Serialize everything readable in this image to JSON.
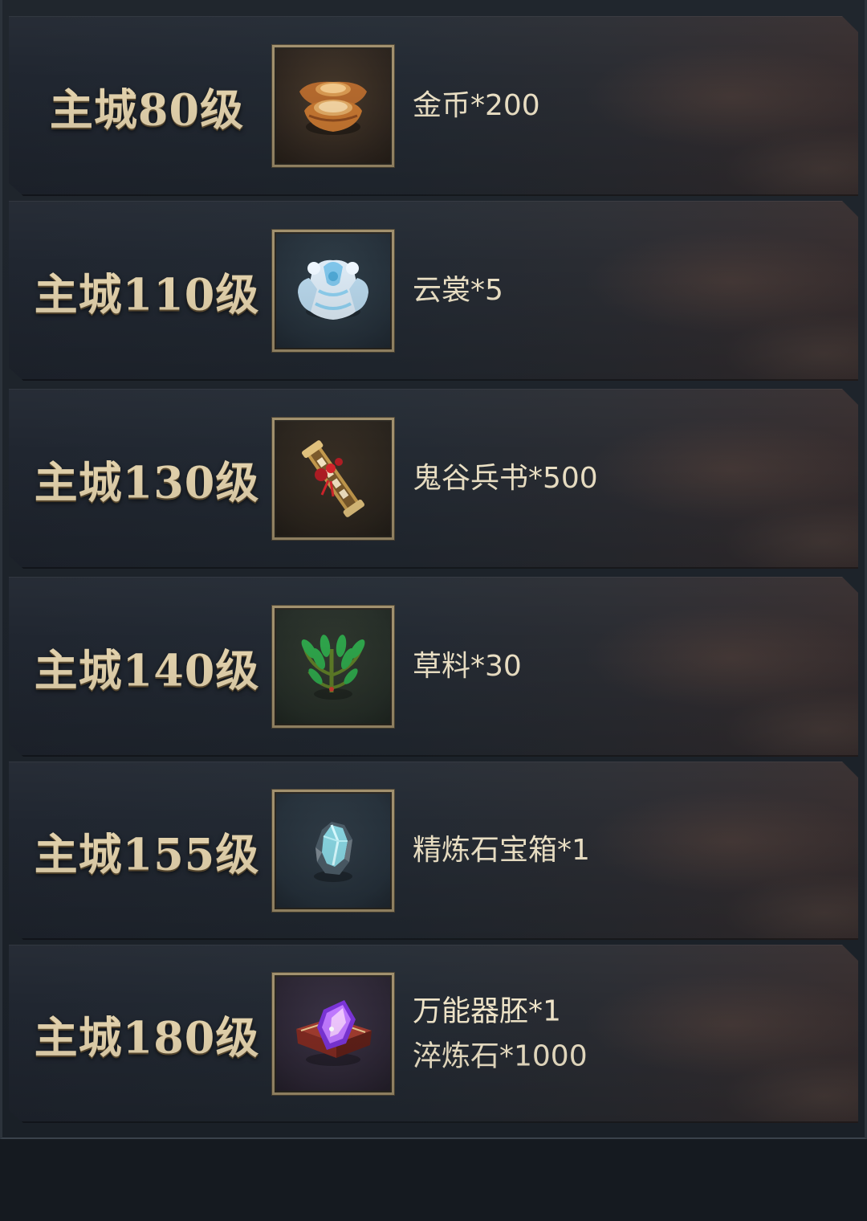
{
  "rows": [
    {
      "level": "主城80级",
      "icon": "gold-ingots",
      "rewards": [
        "金币*200"
      ]
    },
    {
      "level": "主城110级",
      "icon": "cloud-armor",
      "rewards": [
        "云裳*5"
      ]
    },
    {
      "level": "主城130级",
      "icon": "war-scroll",
      "rewards": [
        "鬼谷兵书*500"
      ]
    },
    {
      "level": "主城140级",
      "icon": "herb-bundle",
      "rewards": [
        "草料*30"
      ]
    },
    {
      "level": "主城155级",
      "icon": "crystal-chest",
      "rewards": [
        "精炼石宝箱*1"
      ]
    },
    {
      "level": "主城180级",
      "icon": "purple-crystal-box",
      "rewards": [
        "万能器胚*1",
        "淬炼石*1000"
      ]
    }
  ],
  "colors": {
    "page_background": "#151a20",
    "row_background": "#232a33",
    "level_text": "#e5d4ae",
    "reward_text": "#efe4c8",
    "icon_border": "#a08f6c"
  }
}
